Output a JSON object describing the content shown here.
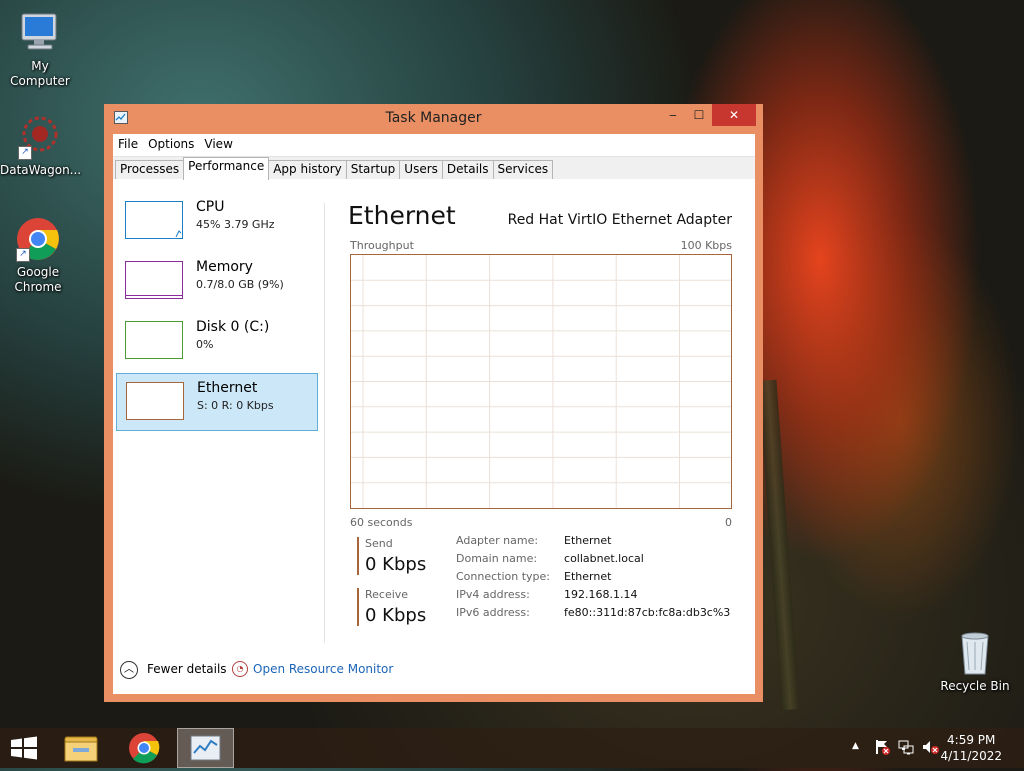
{
  "desktop": {
    "icons": [
      {
        "label": "My Computer",
        "icon": "computer-icon"
      },
      {
        "label": "DataWagon...",
        "icon": "datawagon-icon"
      },
      {
        "label": "Google Chrome",
        "icon": "chrome-icon"
      },
      {
        "label": "Recycle Bin",
        "icon": "recycle-bin-icon"
      }
    ]
  },
  "window": {
    "title": "Task Manager",
    "controls": {
      "minimize": "‒",
      "maximize": "☐",
      "close": "✕"
    },
    "menu": [
      "File",
      "Options",
      "View"
    ],
    "tabs": [
      "Processes",
      "Performance",
      "App history",
      "Startup",
      "Users",
      "Details",
      "Services"
    ],
    "active_tab": "Performance"
  },
  "perf_list": [
    {
      "name": "CPU",
      "value": "45% 3.79 GHz",
      "color": "#1f7fc6"
    },
    {
      "name": "Memory",
      "value": "0.7/8.0 GB (9%)",
      "color": "#8b2a9e"
    },
    {
      "name": "Disk 0 (C:)",
      "value": "0%",
      "color": "#4c9d32"
    },
    {
      "name": "Ethernet",
      "value": "S: 0 R: 0 Kbps",
      "color": "#a7653a"
    }
  ],
  "detail": {
    "title": "Ethernet",
    "adapter": "Red Hat VirtIO Ethernet Adapter",
    "graph_label": "Throughput",
    "graph_max": "100 Kbps",
    "graph_time": "60 seconds",
    "graph_min": "0",
    "send_label": "Send",
    "send_value": "0 Kbps",
    "receive_label": "Receive",
    "receive_value": "0 Kbps",
    "properties": [
      {
        "key": "Adapter name:",
        "value": "Ethernet"
      },
      {
        "key": "Domain name:",
        "value": "collabnet.local"
      },
      {
        "key": "Connection type:",
        "value": "Ethernet"
      },
      {
        "key": "IPv4 address:",
        "value": "192.168.1.14"
      },
      {
        "key": "IPv6 address:",
        "value": "fe80::311d:87cb:fc8a:db3c%3"
      }
    ]
  },
  "footer": {
    "fewer_details": "Fewer details",
    "resource_monitor": "Open Resource Monitor"
  },
  "taskbar": {
    "time": "4:59 PM",
    "date": "4/11/2022",
    "icons": [
      "start-icon",
      "file-explorer-icon",
      "chrome-icon",
      "task-manager-icon"
    ]
  },
  "colors": {
    "window_frame": "#e98f63",
    "close_button": "#c7372f",
    "selection": "#cce8f8",
    "link": "#1c65b8"
  }
}
